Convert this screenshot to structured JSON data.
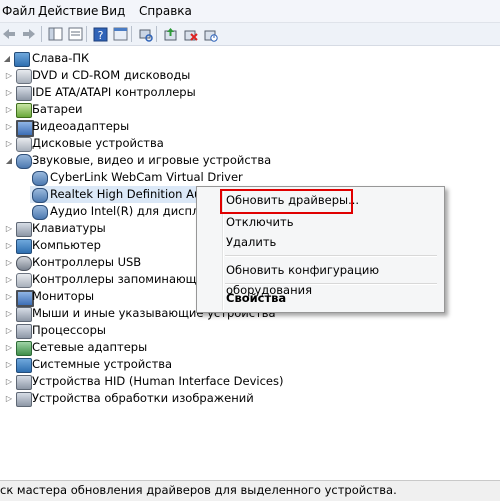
{
  "menubar": {
    "items": [
      "Файл",
      "Действие",
      "Вид",
      "Справка"
    ]
  },
  "toolbar": {
    "buttons": [
      "back-icon",
      "forward-icon",
      "console-tree-icon",
      "properties-icon",
      "help-icon",
      "scan-hardware-icon",
      "update-driver-icon",
      "uninstall-icon",
      "disable-icon"
    ]
  },
  "tree": {
    "root": "Слава-ПК",
    "items": [
      "DVD и CD-ROM дисководы",
      "IDE ATA/ATAPI контроллеры",
      "Батареи",
      "Видеоадаптеры",
      "Дисковые устройства",
      "Звуковые, видео и игровые устройства",
      "CyberLink WebCam Virtual Driver",
      "Realtek High Definition Audio",
      "Аудио Intel(R) для дисплеев",
      "Клавиатуры",
      "Компьютер",
      "Контроллеры USB",
      "Контроллеры запоминающих устройств",
      "Мониторы",
      "Мыши и иные указывающие устройства",
      "Процессоры",
      "Сетевые адаптеры",
      "Системные устройства",
      "Устройства HID (Human Interface Devices)",
      "Устройства обработки изображений"
    ]
  },
  "context_menu": {
    "update_drivers": "Обновить драйверы...",
    "disable": "Отключить",
    "uninstall": "Удалить",
    "scan_hardware": "Обновить конфигурацию оборудования",
    "properties": "Свойства"
  },
  "statusbar": {
    "text": "ск мастера обновления драйверов для выделенного устройства."
  },
  "colors": {
    "highlight_border": "#e00000"
  }
}
